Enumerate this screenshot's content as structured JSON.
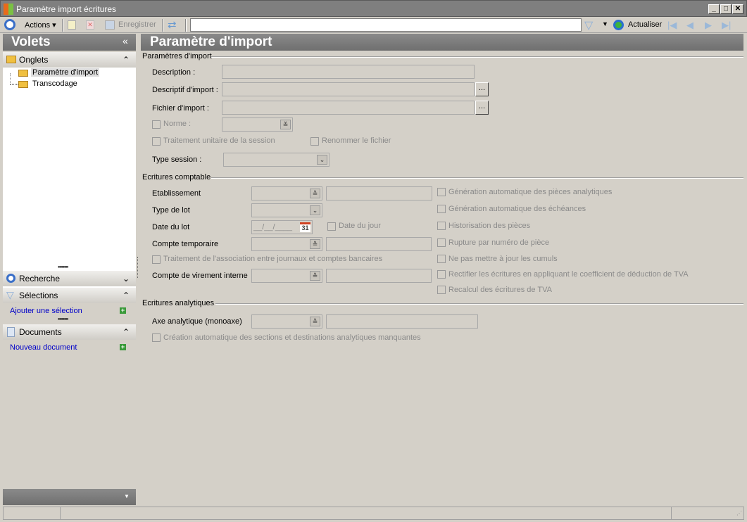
{
  "window": {
    "title": "Paramètre import écritures"
  },
  "toolbar": {
    "actions": "Actions",
    "save": "Enregistrer",
    "search_value": "",
    "refresh": "Actualiser"
  },
  "left": {
    "title": "Volets",
    "collapse": "«",
    "tabs_header": "Onglets",
    "tree": [
      "Paramètre d'import",
      "Transcodage"
    ],
    "recherche": "Recherche",
    "selections": "Sélections",
    "add_selection": "Ajouter une sélection",
    "documents": "Documents",
    "new_document": "Nouveau document"
  },
  "main": {
    "title": "Paramètre d'import",
    "section1": {
      "legend": "Paramètres d'import",
      "description": "Description :",
      "descriptif": "Descriptif d'import :",
      "fichier": "Fichier d'import :",
      "browse": "...",
      "norme": "Norme :",
      "traitement_unitaire": "Traitement unitaire de la session",
      "renommer": "Renommer le fichier",
      "type_session": "Type session :"
    },
    "section2": {
      "legend": "Ecritures comptable",
      "etablissement": "Etablissement",
      "type_lot": "Type de lot",
      "date_lot": "Date du lot",
      "date_placeholder": "__/__/____",
      "calendar_day": "31",
      "date_jour": "Date du jour",
      "compte_temp": "Compte temporaire",
      "traitement_assoc": "Traitement de l'association entre journaux et comptes bancaires",
      "compte_virement": "Compte de virement interne",
      "options": [
        "Génération automatique des pièces analytiques",
        "Génération automatique des échéances",
        "Historisation des pièces",
        "Rupture par numéro de pièce",
        "Ne pas mettre à jour les cumuls",
        "Rectifier les écritures en appliquant le coefficient de déduction de TVA",
        "Recalcul des écritures de TVA"
      ]
    },
    "section3": {
      "legend": "Ecritures analytiques",
      "axe": "Axe analytique (monoaxe)",
      "creation": "Création automatique des sections et destinations analytiques manquantes"
    }
  }
}
